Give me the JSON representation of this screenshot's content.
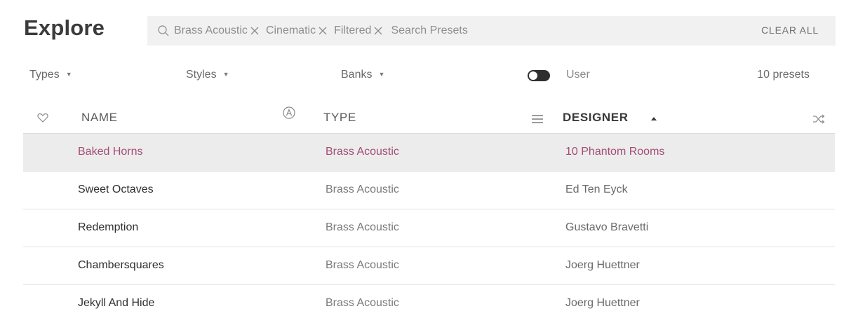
{
  "header": {
    "title": "Explore",
    "search": {
      "chips": [
        {
          "label": "Brass Acoustic"
        },
        {
          "label": "Cinematic"
        },
        {
          "label": "Filtered"
        }
      ],
      "placeholder": "Search Presets",
      "value": ""
    },
    "clear_all_label": "CLEAR ALL"
  },
  "filters": {
    "types_label": "Types",
    "styles_label": "Styles",
    "banks_label": "Banks",
    "user_toggle_on": false,
    "user_label": "User",
    "preset_count": "10 presets"
  },
  "table": {
    "columns": {
      "name": "NAME",
      "type": "TYPE",
      "designer": "DESIGNER"
    },
    "sort": {
      "column": "designer",
      "direction": "ascending"
    },
    "rows": [
      {
        "name": "Baked Horns",
        "type": "Brass Acoustic",
        "designer": "10 Phantom Rooms",
        "selected": true
      },
      {
        "name": "Sweet Octaves",
        "type": "Brass Acoustic",
        "designer": "Ed Ten Eyck",
        "selected": false
      },
      {
        "name": "Redemption",
        "type": "Brass Acoustic",
        "designer": "Gustavo Bravetti",
        "selected": false
      },
      {
        "name": "Chambersquares",
        "type": "Brass Acoustic",
        "designer": "Joerg Huettner",
        "selected": false
      },
      {
        "name": "Jekyll And Hide",
        "type": "Brass Acoustic",
        "designer": "Joerg Huettner",
        "selected": false
      }
    ]
  },
  "colors": {
    "accent_selected_text": "#a24d74",
    "selected_row_bg": "#ececec",
    "search_bg": "#f1f1f1"
  },
  "icons": {
    "search": "search-icon",
    "chip_remove": "close-icon",
    "favorite": "heart-icon",
    "artist_filter": "circled-a-icon",
    "column_menu": "hamburger-icon",
    "sort_direction": "caret-up-icon",
    "shuffle": "shuffle-icon"
  }
}
